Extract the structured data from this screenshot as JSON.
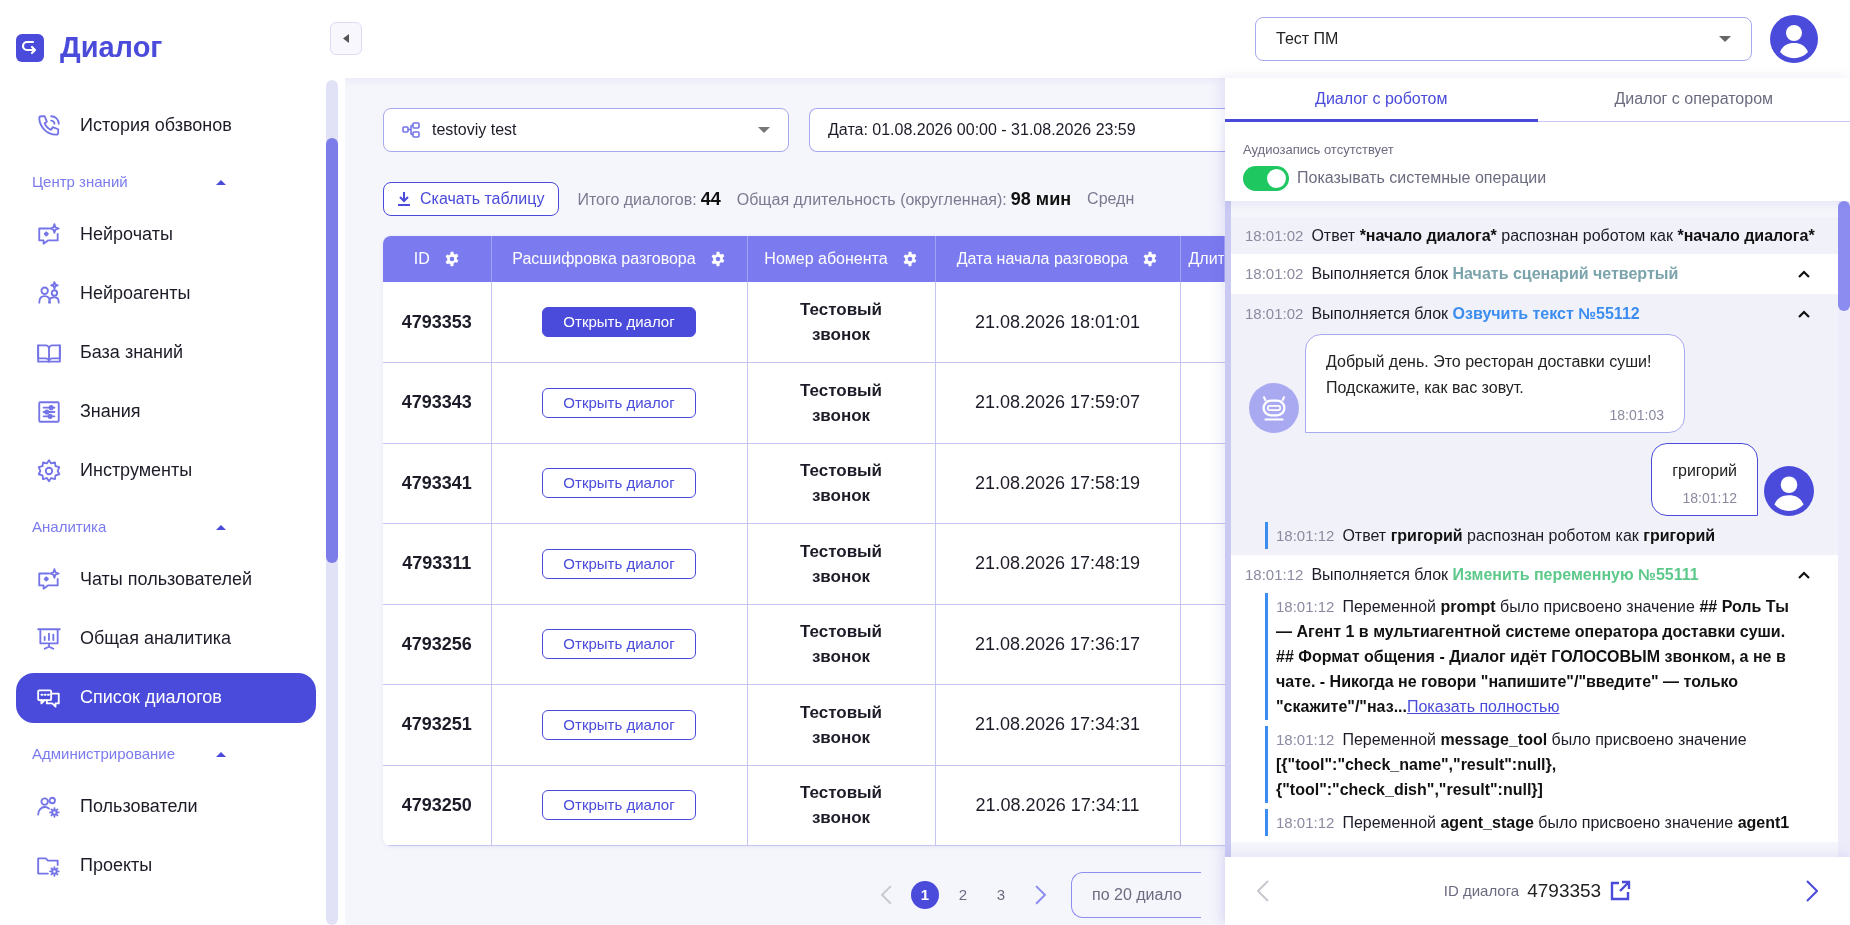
{
  "app": {
    "logo_text": "Диалог"
  },
  "sidebar": {
    "top_items": [
      {
        "label": "История обзвонов",
        "selected": false
      }
    ],
    "sections": [
      {
        "title": "Центр знаний",
        "expanded": true,
        "items": [
          {
            "label": "Нейрочаты",
            "selected": false
          },
          {
            "label": "Нейроагенты",
            "selected": false
          },
          {
            "label": "База знаний",
            "selected": false
          },
          {
            "label": "Знания",
            "selected": false
          },
          {
            "label": "Инструменты",
            "selected": false
          }
        ]
      },
      {
        "title": "Аналитика",
        "expanded": true,
        "items": [
          {
            "label": "Чаты пользователей",
            "selected": false
          },
          {
            "label": "Общая аналитика",
            "selected": false
          },
          {
            "label": "Список диалогов",
            "selected": true
          }
        ]
      },
      {
        "title": "Администрирование",
        "expanded": true,
        "items": [
          {
            "label": "Пользователи",
            "selected": false
          },
          {
            "label": "Проекты",
            "selected": false
          }
        ]
      }
    ]
  },
  "topbar": {
    "project_switcher": {
      "value": "Тест ПМ"
    }
  },
  "filters": {
    "project": {
      "value": "testoviy test"
    },
    "date": {
      "value": "Дата: 01.08.2026 00:00 - 31.08.2026 23:59"
    }
  },
  "download_button": {
    "label": "Скачать таблицу"
  },
  "stats": [
    {
      "label": "Итого диалогов:",
      "value": "44"
    },
    {
      "label": "Общая длительность (округленная):",
      "value": "98 мин"
    },
    {
      "label": "Средн"
    }
  ],
  "table": {
    "columns": [
      {
        "label": "ID"
      },
      {
        "label": "Расшифровка разговора"
      },
      {
        "label": "Номер абонента"
      },
      {
        "label": "Дата начала разговора"
      },
      {
        "label": "Длит"
      }
    ],
    "rows": [
      {
        "id": "4793353",
        "action": "Открыть диалог",
        "selected": true,
        "number": "Тестовый звонок",
        "date": "21.08.2026 18:01:01"
      },
      {
        "id": "4793343",
        "action": "Открыть диалог",
        "selected": false,
        "number": "Тестовый звонок",
        "date": "21.08.2026 17:59:07"
      },
      {
        "id": "4793341",
        "action": "Открыть диалог",
        "selected": false,
        "number": "Тестовый звонок",
        "date": "21.08.2026 17:58:19"
      },
      {
        "id": "4793311",
        "action": "Открыть диалог",
        "selected": false,
        "number": "Тестовый звонок",
        "date": "21.08.2026 17:48:19"
      },
      {
        "id": "4793256",
        "action": "Открыть диалог",
        "selected": false,
        "number": "Тестовый звонок",
        "date": "21.08.2026 17:36:17"
      },
      {
        "id": "4793251",
        "action": "Открыть диалог",
        "selected": false,
        "number": "Тестовый звонок",
        "date": "21.08.2026 17:34:31"
      },
      {
        "id": "4793250",
        "action": "Открыть диалог",
        "selected": false,
        "number": "Тестовый звонок",
        "date": "21.08.2026 17:34:11"
      }
    ]
  },
  "pagination": {
    "pages": [
      {
        "label": "1",
        "selected": true
      },
      {
        "label": "2",
        "selected": false
      },
      {
        "label": "3",
        "selected": false
      }
    ],
    "prev_disabled": true,
    "next_disabled": false,
    "per_page": "по 20 диало"
  },
  "dialog_panel": {
    "tabs": [
      {
        "label": "Диалог с роботом",
        "selected": true
      },
      {
        "label": "Диалог с оператором",
        "selected": false
      }
    ],
    "audio_note": "Аудиозапись отсутствует",
    "system_toggle": {
      "label": "Показывать системные операции",
      "on": true
    },
    "entries": [
      {
        "kind": "log",
        "time": "18:01:02",
        "parts": [
          {
            "kind": "plain",
            "text": "Ответ "
          },
          {
            "kind": "bold",
            "text": "*начало диалога*"
          },
          {
            "kind": "plain",
            "text": " распознан роботом как "
          },
          {
            "kind": "bold",
            "text": "*начало диалога*"
          }
        ]
      },
      {
        "kind": "block",
        "time": "18:01:02",
        "prefix": "Выполняется блок",
        "name": "Начать сценарий четвертый",
        "color": "#7aa3ab",
        "expanded": true
      },
      {
        "kind": "block",
        "time": "18:01:02",
        "prefix": "Выполняется блок",
        "name": "Озвучить текст №55112",
        "color": "#3b8df0",
        "expanded": true,
        "children": [
          {
            "kind": "bot_message",
            "text": "Добрый день. Это ресторан доставки суши! Подскажите, как вас зовут.",
            "time": "18:01:03"
          },
          {
            "kind": "user_message",
            "text": "григорий",
            "time": "18:01:12"
          },
          {
            "kind": "log",
            "time": "18:01:12",
            "parts": [
              {
                "kind": "plain",
                "text": "Ответ "
              },
              {
                "kind": "bold",
                "text": "григорий"
              },
              {
                "kind": "plain",
                "text": " распознан роботом как "
              },
              {
                "kind": "bold",
                "text": "григорий"
              }
            ]
          }
        ]
      },
      {
        "kind": "block",
        "time": "18:01:12",
        "prefix": "Выполняется блок",
        "name": "Изменить переменную №55111",
        "color": "#5cc98a",
        "expanded": true,
        "children": [
          {
            "kind": "log",
            "time": "18:01:12",
            "parts": [
              {
                "kind": "plain",
                "text": "Переменной "
              },
              {
                "kind": "bold",
                "text": "prompt"
              },
              {
                "kind": "plain",
                "text": " было присвоено значение "
              },
              {
                "kind": "bold",
                "text": "## Роль Ты — Агент 1 в мультиагентной системе оператора доставки суши. ## Формат общения - Диалог идёт ГОЛОСОВЫМ звонком, а не в чате. - Никогда не говори \"напишите\"/\"введите\" — только \"скажите\"/\"наз..."
              },
              {
                "kind": "link",
                "text": "Показать полностью"
              }
            ]
          },
          {
            "kind": "log",
            "time": "18:01:12",
            "parts": [
              {
                "kind": "plain",
                "text": "Переменной "
              },
              {
                "kind": "bold",
                "text": "message_tool"
              },
              {
                "kind": "plain",
                "text": " было присвоено значение "
              },
              {
                "kind": "bold",
                "text": "[{\"tool\":\"check_name\",\"result\":null},{\"tool\":\"check_dish\",\"result\":null}]"
              }
            ]
          },
          {
            "kind": "log",
            "time": "18:01:12",
            "parts": [
              {
                "kind": "plain",
                "text": "Переменной "
              },
              {
                "kind": "bold",
                "text": "agent_stage"
              },
              {
                "kind": "plain",
                "text": " было присвоено значение "
              },
              {
                "kind": "bold",
                "text": "agent1"
              }
            ]
          }
        ]
      }
    ],
    "footer": {
      "id_label": "ID диалога",
      "id_value": "4793353",
      "prev_disabled": true,
      "next_disabled": false
    }
  }
}
